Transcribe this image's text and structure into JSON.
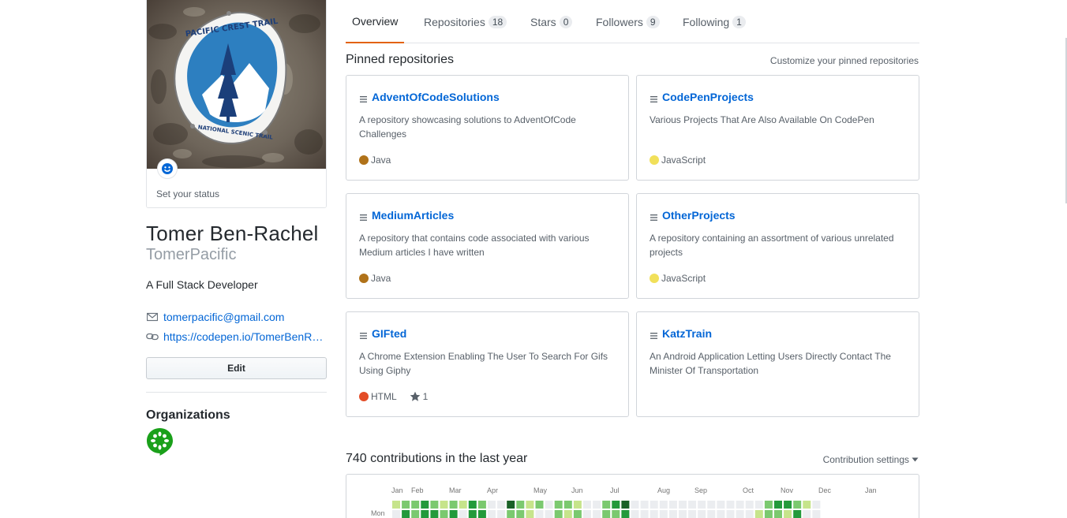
{
  "profile": {
    "status_text": "Set your status",
    "fullname": "Tomer Ben-Rachel",
    "username": "TomerPacific",
    "bio": "A Full Stack Developer",
    "email": "tomerpacific@gmail.com",
    "website": "https://codepen.io/TomerBenRachel",
    "edit_label": "Edit",
    "organizations_title": "Organizations",
    "avatar_sign_text_top": "PACIFIC CREST TRAIL",
    "avatar_sign_text_bottom": "NATIONAL SCENIC TRAIL"
  },
  "tabs": [
    {
      "label": "Overview",
      "count": null,
      "active": true
    },
    {
      "label": "Repositories",
      "count": "18",
      "active": false
    },
    {
      "label": "Stars",
      "count": "0",
      "active": false
    },
    {
      "label": "Followers",
      "count": "9",
      "active": false
    },
    {
      "label": "Following",
      "count": "1",
      "active": false
    }
  ],
  "pinned": {
    "title": "Pinned repositories",
    "customize_label": "Customize your pinned repositories",
    "repos": [
      {
        "name": "AdventOfCodeSolutions",
        "description": "A repository showcasing solutions to AdventOfCode Challenges",
        "language": "Java",
        "language_color": "#b07219",
        "stars": null
      },
      {
        "name": "CodePenProjects",
        "description": "Various Projects That Are Also Available On CodePen",
        "language": "JavaScript",
        "language_color": "#f1e05a",
        "stars": null
      },
      {
        "name": "MediumArticles",
        "description": "A repository that contains code associated with various Medium articles I have written",
        "language": "Java",
        "language_color": "#b07219",
        "stars": null
      },
      {
        "name": "OtherProjects",
        "description": "A repository containing an assortment of various unrelated projects",
        "language": "JavaScript",
        "language_color": "#f1e05a",
        "stars": null
      },
      {
        "name": "GIFted",
        "description": "A Chrome Extension Enabling The User To Search For Gifs Using Giphy",
        "language": "HTML",
        "language_color": "#e34c26",
        "stars": "1"
      },
      {
        "name": "KatzTrain",
        "description": "An Android Application Letting Users Directly Contact The Minister Of Transportation",
        "language": null,
        "language_color": null,
        "stars": null
      }
    ]
  },
  "contributions": {
    "title": "740 contributions in the last year",
    "settings_label": "Contribution settings",
    "months": [
      "Jan",
      "Feb",
      "Mar",
      "Apr",
      "May",
      "Jun",
      "Jul",
      "Aug",
      "Sep",
      "Oct",
      "Nov",
      "Dec",
      "Jan"
    ],
    "weekday_label": "Mon",
    "levels_row0": [
      1,
      2,
      2,
      3,
      2,
      1,
      2,
      1,
      3,
      2,
      0,
      0,
      4,
      2,
      1,
      2,
      0,
      2,
      2,
      1,
      0,
      0,
      2,
      3,
      4,
      0,
      0,
      0,
      0,
      0,
      0,
      0,
      0,
      0,
      0,
      0,
      0,
      0,
      0,
      2,
      3,
      3,
      2,
      1,
      0
    ],
    "levels_row1": [
      0,
      3,
      2,
      3,
      3,
      2,
      3,
      0,
      3,
      3,
      0,
      0,
      2,
      2,
      1,
      0,
      0,
      2,
      1,
      2,
      0,
      0,
      2,
      2,
      3,
      0,
      0,
      0,
      0,
      0,
      0,
      0,
      0,
      0,
      0,
      0,
      0,
      0,
      1,
      2,
      2,
      1,
      3,
      0,
      0
    ],
    "level_colors": [
      "#ebedf0",
      "#c6e48b",
      "#7bc96f",
      "#239a3b",
      "#196127"
    ]
  },
  "colors": {
    "link": "#0366d6",
    "tab_active_border": "#e36209",
    "org_green": "#1aa01a"
  }
}
